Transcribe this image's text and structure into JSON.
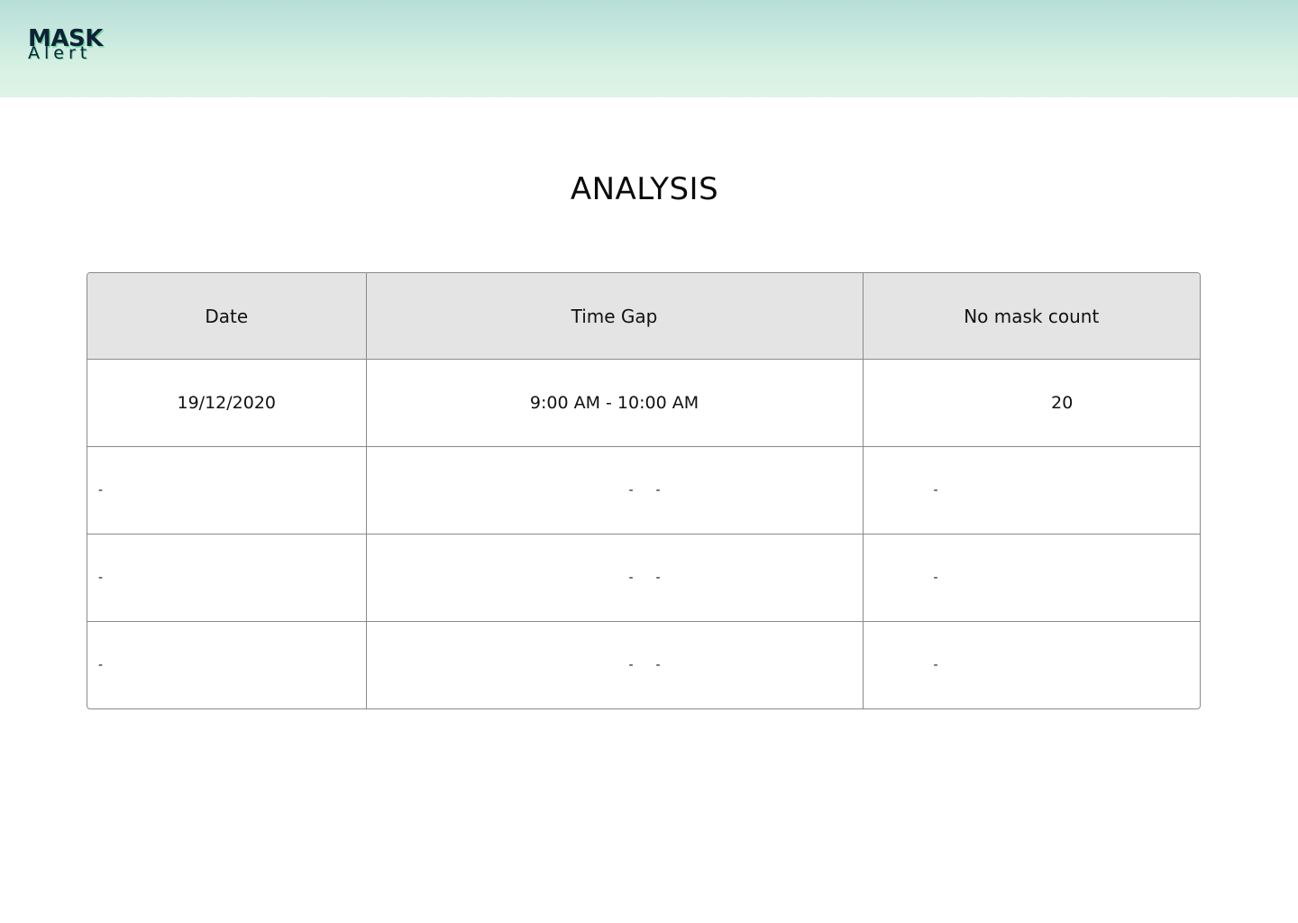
{
  "header": {
    "logo_top": "MASK",
    "logo_bottom": "Alert"
  },
  "page": {
    "title": "ANALYSIS"
  },
  "table": {
    "headers": [
      "Date",
      "Time Gap",
      "No mask count"
    ],
    "rows": [
      {
        "date": "19/12/2020",
        "time_gap": "9:00 AM - 10:00 AM",
        "count": "20"
      },
      {
        "date": "-",
        "time_start": "-",
        "time_end": "-",
        "count": "-"
      },
      {
        "date": "-",
        "time_start": "-",
        "time_end": "-",
        "count": "-"
      },
      {
        "date": "-",
        "time_start": "-",
        "time_end": "-",
        "count": "-"
      }
    ]
  },
  "colors": {
    "header_gradient_top": "#b7ded8",
    "header_gradient_bottom": "#dff5e8",
    "table_header_bg": "#e4e4e4",
    "logo_text": "#0e2236",
    "logo_accent": "#6fd8a6"
  }
}
